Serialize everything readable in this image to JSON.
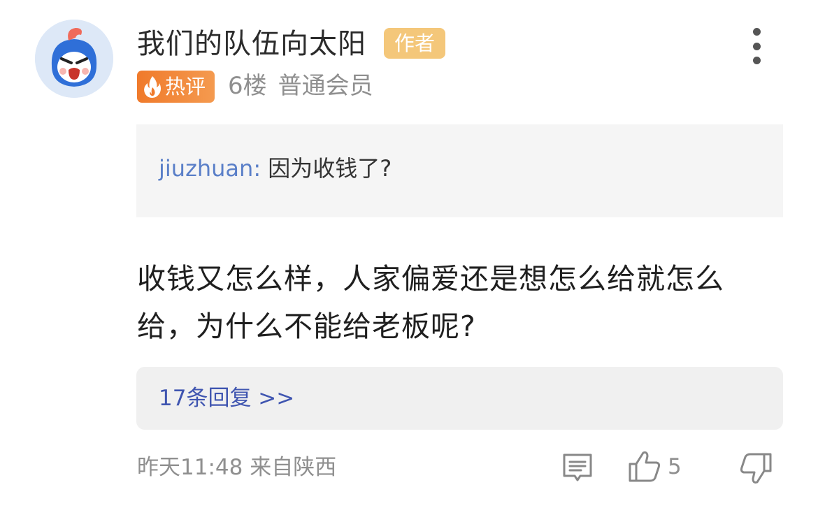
{
  "user": {
    "name": "我们的队伍向太阳",
    "author_badge": "作者",
    "hot_badge": "热评",
    "floor": "6楼",
    "level": "普通会员"
  },
  "quote": {
    "user": "jiuzhuan:",
    "text": "因为收钱了?"
  },
  "comment": {
    "text": "收钱又怎么样，人家偏爱还是想怎么给就怎么给，为什么不能给老板呢?"
  },
  "replies": {
    "link": "17条回复 >>"
  },
  "footer": {
    "time_location": "昨天11:48 来自陕西",
    "like_count": "5"
  },
  "icons": {
    "avatar": "angry-cartoon-avatar",
    "more": "more-vertical-icon",
    "fire": "fire-icon",
    "reply": "comment-icon",
    "like": "thumbs-up-icon",
    "dislike": "thumbs-down-icon"
  },
  "colors": {
    "author_badge": "#f4c77a",
    "hot_badge": "#f07a2b",
    "quote_user": "#5a7fc8",
    "replies_link": "#3f55b0",
    "muted_text": "#8f8f8f"
  }
}
